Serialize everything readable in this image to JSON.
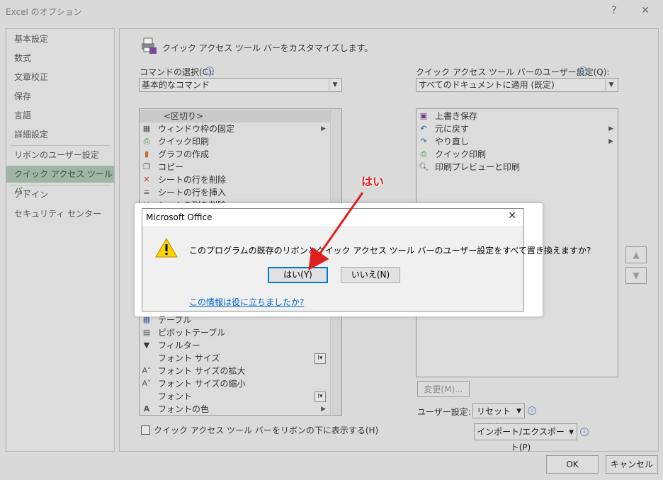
{
  "window": {
    "title": "Excel のオプション",
    "help": "?",
    "close": "✕"
  },
  "nav": {
    "items": [
      "基本設定",
      "数式",
      "文章校正",
      "保存",
      "言語",
      "詳細設定",
      "リボンのユーザー設定",
      "クイック アクセス ツール バー",
      "アドイン",
      "セキュリティ センター"
    ],
    "selected_index": 7
  },
  "header": {
    "text": "クイック アクセス ツール バーをカスタマイズします。"
  },
  "left": {
    "label": "コマンドの選択(C):",
    "combo_value": "基本的なコマンド",
    "items": [
      {
        "icon": "",
        "label": "<区切り>"
      },
      {
        "icon": "freeze-panes-icon",
        "label": "ウィンドウ枠の固定",
        "submenu": true
      },
      {
        "icon": "quick-print-icon",
        "label": "クイック印刷"
      },
      {
        "icon": "chart-icon",
        "label": "グラフの作成"
      },
      {
        "icon": "copy-icon",
        "label": "コピー"
      },
      {
        "icon": "delete-row-icon",
        "label": "シートの行を削除"
      },
      {
        "icon": "insert-row-icon",
        "label": "シートの行を挿入"
      },
      {
        "icon": "delete-col-icon",
        "label": "シートの列を削除"
      },
      {
        "icon": "table-icon",
        "label": "テーブル"
      },
      {
        "icon": "pivot-icon",
        "label": "ピボットテーブル"
      },
      {
        "icon": "filter-icon",
        "label": "フィルター"
      },
      {
        "icon": "",
        "label": "フォント サイズ",
        "combo": true
      },
      {
        "icon": "font-grow-icon",
        "label": "フォント サイズの拡大"
      },
      {
        "icon": "font-shrink-icon",
        "label": "フォント サイズの縮小"
      },
      {
        "icon": "",
        "label": "フォント",
        "combo": true
      },
      {
        "icon": "font-color-icon",
        "label": "フォントの色",
        "submenu": true
      }
    ],
    "checkbox_label": "クイック アクセス ツール バーをリボンの下に表示する(H)"
  },
  "right": {
    "label": "クイック アクセス ツール バーのユーザー設定(Q):",
    "combo_value": "すべてのドキュメントに適用 (既定)",
    "items": [
      {
        "icon": "save-icon",
        "label": "上書き保存"
      },
      {
        "icon": "undo-icon",
        "label": "元に戻す",
        "submenu": true
      },
      {
        "icon": "redo-icon",
        "label": "やり直し",
        "submenu": true
      },
      {
        "icon": "quick-print-icon",
        "label": "クイック印刷"
      },
      {
        "icon": "print-preview-icon",
        "label": "印刷プレビューと印刷"
      }
    ],
    "modify_button": "変更(M)...",
    "custom_label": "ユーザー設定:",
    "reset_button": "リセット(E)",
    "import_export_button": "インポート/エクスポート(P)"
  },
  "footer": {
    "ok": "OK",
    "cancel": "キャンセル"
  },
  "dialog": {
    "title": "Microsoft Office",
    "close": "✕",
    "message": "このプログラムの既存のリボンとクイック アクセス ツール バーのユーザー設定をすべて置き換えますか?",
    "yes": "はい(Y)",
    "no": "いいえ(N)",
    "link": "この情報は役に立ちましたか?"
  },
  "annotation": {
    "text": "はい",
    "color": "#e02020"
  }
}
